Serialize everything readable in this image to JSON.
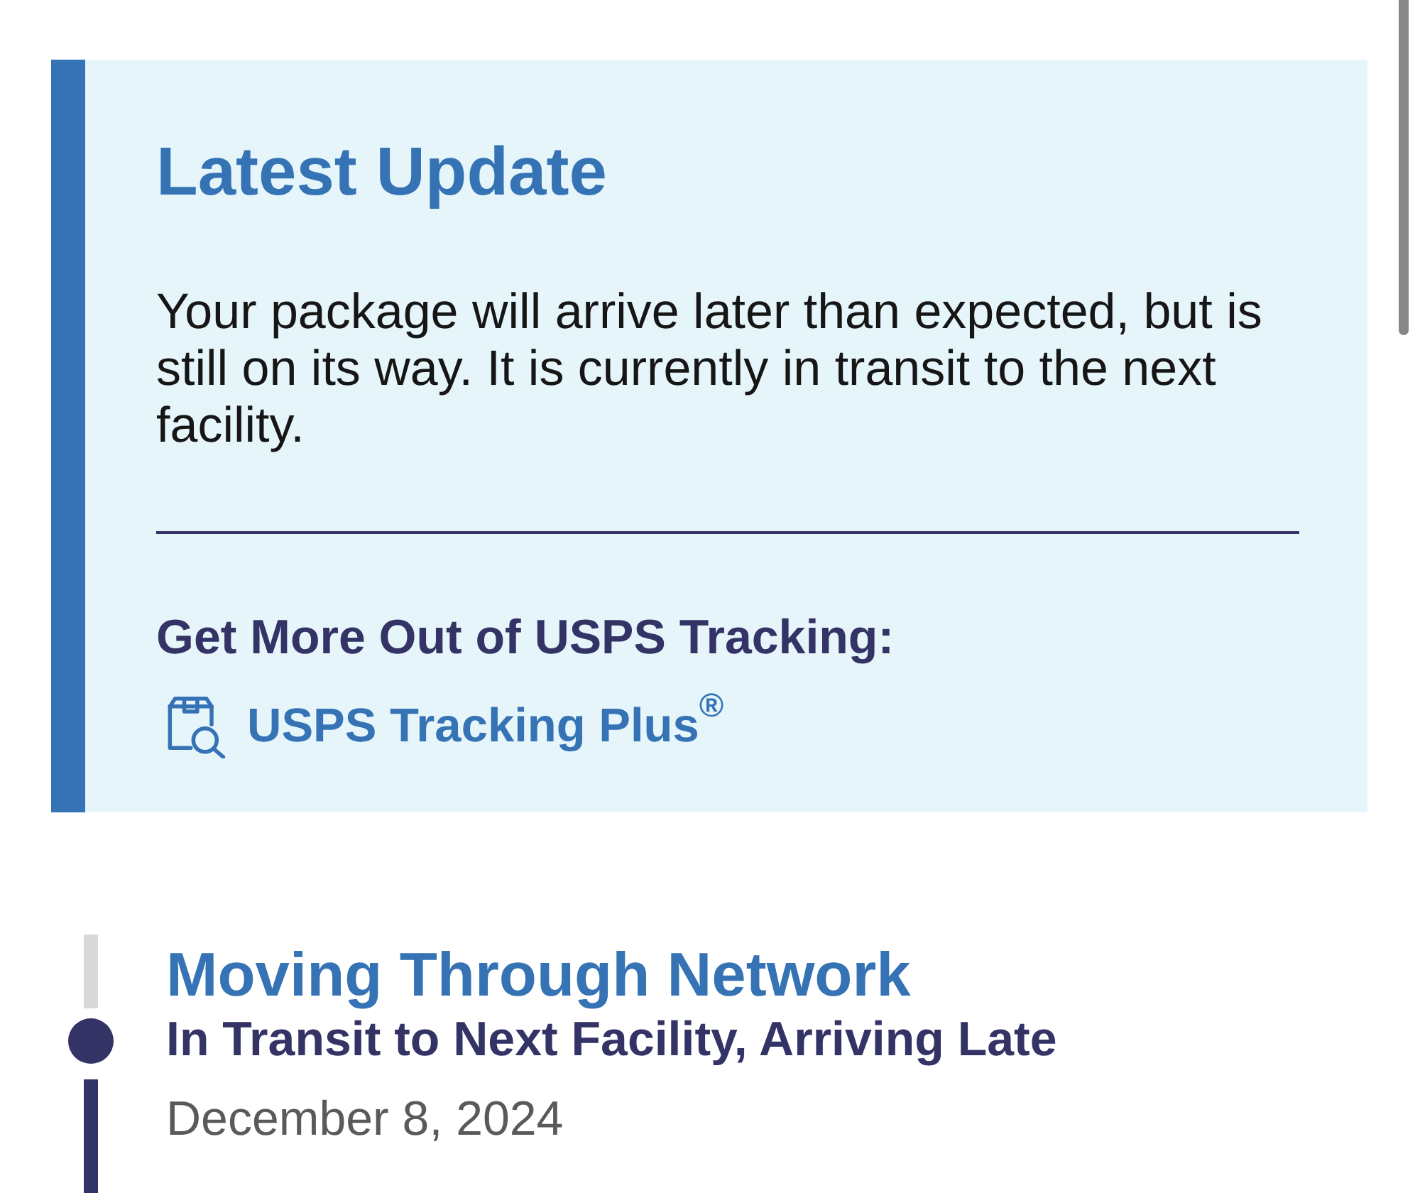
{
  "latest_update": {
    "title": "Latest Update",
    "message": "Your package will arrive later than expected, but is still on its way. It is currently in transit to the next facility.",
    "promo_heading": "Get More Out of USPS Tracking:",
    "promo_link": "USPS Tracking Plus$^{®}$"
  },
  "tracking_history": [
    {
      "status": "Moving Through Network",
      "detail": "In Transit to Next Facility, Arriving Late",
      "date": "December 8, 2024"
    }
  ]
}
